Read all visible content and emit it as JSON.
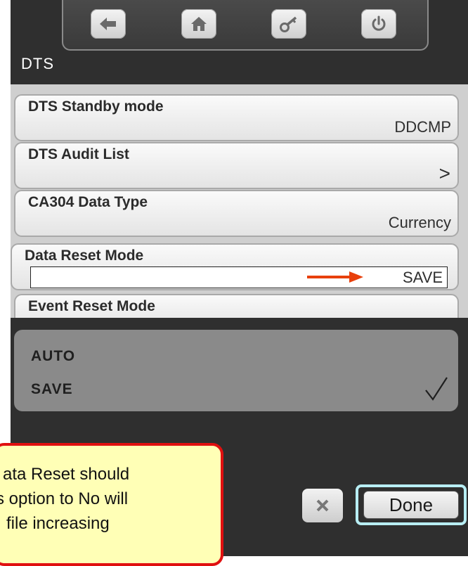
{
  "toolbar": {
    "buttons": [
      {
        "icon": "arrow-left-icon"
      },
      {
        "icon": "home-icon"
      },
      {
        "icon": "key-icon"
      },
      {
        "icon": "power-icon"
      }
    ]
  },
  "screen_title": "DTS",
  "settings": [
    {
      "label": "DTS Standby mode",
      "value": "DDCMP"
    },
    {
      "label": "DTS Audit List",
      "value": ">"
    },
    {
      "label": "CA304 Data Type",
      "value": "Currency"
    },
    {
      "label": "Data Reset Mode",
      "value": "SAVE"
    },
    {
      "label": "Event Reset Mode",
      "value": ""
    }
  ],
  "options": [
    {
      "label": "AUTO",
      "selected": false
    },
    {
      "label": "SAVE",
      "selected": true
    }
  ],
  "buttons": {
    "done": "Done"
  },
  "callout": {
    "lines": [
      "ata Reset should",
      "s option to No will",
      "file increasing"
    ]
  },
  "colors": {
    "annotation_arrow": "#e8400c",
    "callout_border": "#e01010",
    "callout_fill": "#ffffb6",
    "done_highlight": "#b8eef4"
  }
}
